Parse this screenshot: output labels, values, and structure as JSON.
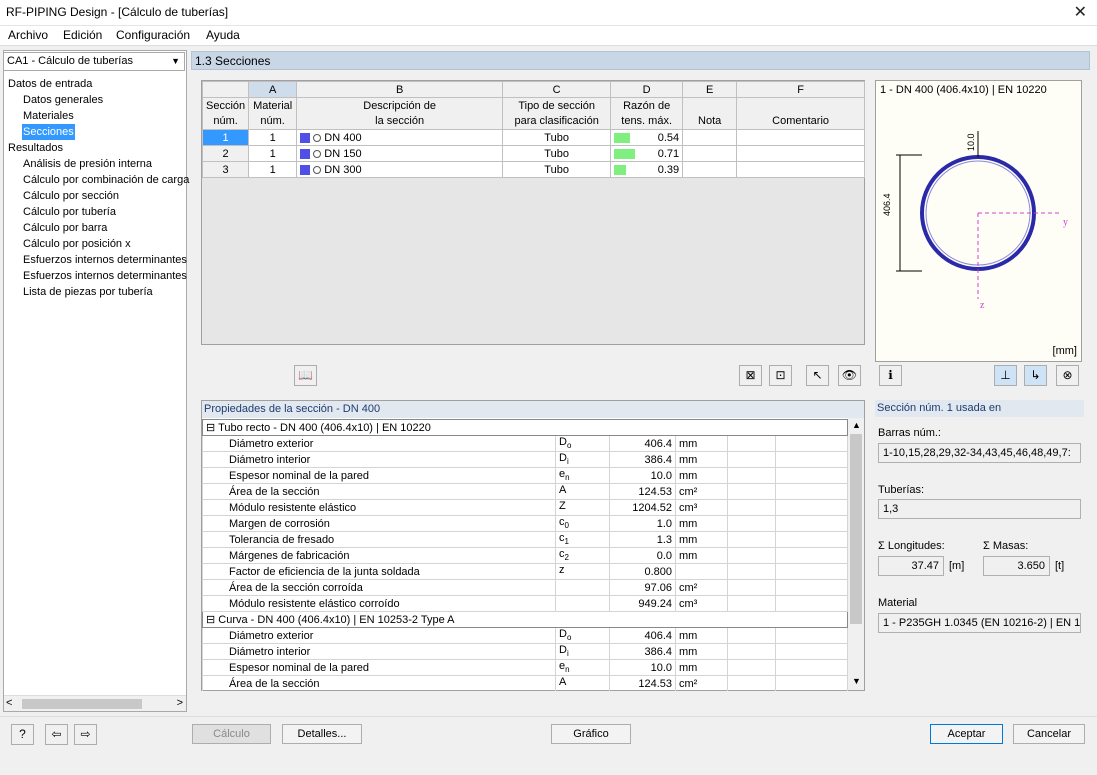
{
  "window": {
    "title": "RF-PIPING Design - [Cálculo de tuberías]"
  },
  "menu": [
    "Archivo",
    "Edición",
    "Configuración",
    "Ayuda"
  ],
  "case_select": "CA1 - Cálculo de tuberías",
  "tree": {
    "input_group": "Datos de entrada",
    "input_items": [
      "Datos generales",
      "Materiales",
      "Secciones"
    ],
    "results_group": "Resultados",
    "result_items": [
      "Análisis de presión interna",
      "Cálculo por combinación de carga",
      "Cálculo por sección",
      "Cálculo por tubería",
      "Cálculo por barra",
      "Cálculo por posición x",
      "Esfuerzos internos determinantes",
      "Esfuerzos internos determinantes",
      "Lista de piezas por tubería"
    ]
  },
  "section_header": "1.3 Secciones",
  "table": {
    "col_letters": [
      "A",
      "B",
      "C",
      "D",
      "E",
      "F"
    ],
    "row_header_1": "Sección",
    "row_header_2": "núm.",
    "headers_1": [
      "Material",
      "Descripción de",
      "Tipo de sección",
      "Razón de",
      "",
      ""
    ],
    "headers_2": [
      "núm.",
      "la sección",
      "para clasificación",
      "tens. máx.",
      "Nota",
      "Comentario"
    ],
    "rows": [
      {
        "no": "1",
        "material": "1",
        "desc": "DN 400",
        "type": "Tubo",
        "ratio": "0.54",
        "ratio_val": 0.54
      },
      {
        "no": "2",
        "material": "1",
        "desc": "DN 150",
        "type": "Tubo",
        "ratio": "0.71",
        "ratio_val": 0.71
      },
      {
        "no": "3",
        "material": "1",
        "desc": "DN 300",
        "type": "Tubo",
        "ratio": "0.39",
        "ratio_val": 0.39
      }
    ]
  },
  "preview": {
    "title": "1 - DN 400 (406.4x10) | EN 10220",
    "dim_height": "406.4",
    "dim_thickness": "10.0",
    "axis_y": "y",
    "axis_z": "z",
    "unit": "[mm]"
  },
  "properties": {
    "header": "Propiedades de la sección  -  DN 400",
    "groups": [
      {
        "title": "Tubo recto - DN 400 (406.4x10) | EN 10220",
        "rows": [
          {
            "name": "Diámetro exterior",
            "sym": "D",
            "sub": "o",
            "val": "406.4",
            "unit": "mm"
          },
          {
            "name": "Diámetro interior",
            "sym": "D",
            "sub": "i",
            "val": "386.4",
            "unit": "mm"
          },
          {
            "name": "Espesor nominal de la pared",
            "sym": "e",
            "sub": "n",
            "val": "10.0",
            "unit": "mm"
          },
          {
            "name": "Área de la sección",
            "sym": "A",
            "sub": "",
            "val": "124.53",
            "unit": "cm²"
          },
          {
            "name": "Módulo resistente elástico",
            "sym": "Z",
            "sub": "",
            "val": "1204.52",
            "unit": "cm³"
          },
          {
            "name": "Margen de corrosión",
            "sym": "c",
            "sub": "0",
            "val": "1.0",
            "unit": "mm"
          },
          {
            "name": "Tolerancia de fresado",
            "sym": "c",
            "sub": "1",
            "val": "1.3",
            "unit": "mm"
          },
          {
            "name": "Márgenes de fabricación",
            "sym": "c",
            "sub": "2",
            "val": "0.0",
            "unit": "mm"
          },
          {
            "name": "Factor de eficiencia de la junta soldada",
            "sym": "z",
            "sub": "",
            "val": "0.800",
            "unit": ""
          },
          {
            "name": "Área de la sección corroída",
            "sym": "",
            "sub": "",
            "val": "97.06",
            "unit": "cm²"
          },
          {
            "name": "Módulo resistente elástico corroído",
            "sym": "",
            "sub": "",
            "val": "949.24",
            "unit": "cm³"
          }
        ]
      },
      {
        "title": "Curva - DN 400 (406.4x10) | EN 10253-2 Type A",
        "rows": [
          {
            "name": "Diámetro exterior",
            "sym": "D",
            "sub": "o",
            "val": "406.4",
            "unit": "mm"
          },
          {
            "name": "Diámetro interior",
            "sym": "D",
            "sub": "i",
            "val": "386.4",
            "unit": "mm"
          },
          {
            "name": "Espesor nominal de la pared",
            "sym": "e",
            "sub": "n",
            "val": "10.0",
            "unit": "mm"
          },
          {
            "name": "Área de la sección",
            "sym": "A",
            "sub": "",
            "val": "124.53",
            "unit": "cm²"
          }
        ]
      }
    ]
  },
  "usage": {
    "header": "Sección núm. 1 usada en",
    "members_label": "Barras núm.:",
    "members_value": "1-10,15,28,29,32-34,43,45,46,48,49,7:",
    "pipes_label": "Tuberías:",
    "pipes_value": "1,3",
    "lengths_label": "Σ Longitudes:",
    "lengths_value": "37.47",
    "lengths_unit": "[m]",
    "masses_label": "Σ Masas:",
    "masses_value": "3.650",
    "masses_unit": "[t]",
    "material_label": "Material",
    "material_value": "1 - P235GH 1.0345 (EN 10216-2) | EN 1:"
  },
  "buttons": {
    "calc": "Cálculo",
    "details": "Detalles...",
    "graphic": "Gráfico",
    "ok": "Aceptar",
    "cancel": "Cancelar"
  },
  "colors": {
    "selection": "#3399ff",
    "ratio_bar": "#7fef7f",
    "section_icon": "#5050e6",
    "pipe_ring": "#2a2aa8"
  }
}
